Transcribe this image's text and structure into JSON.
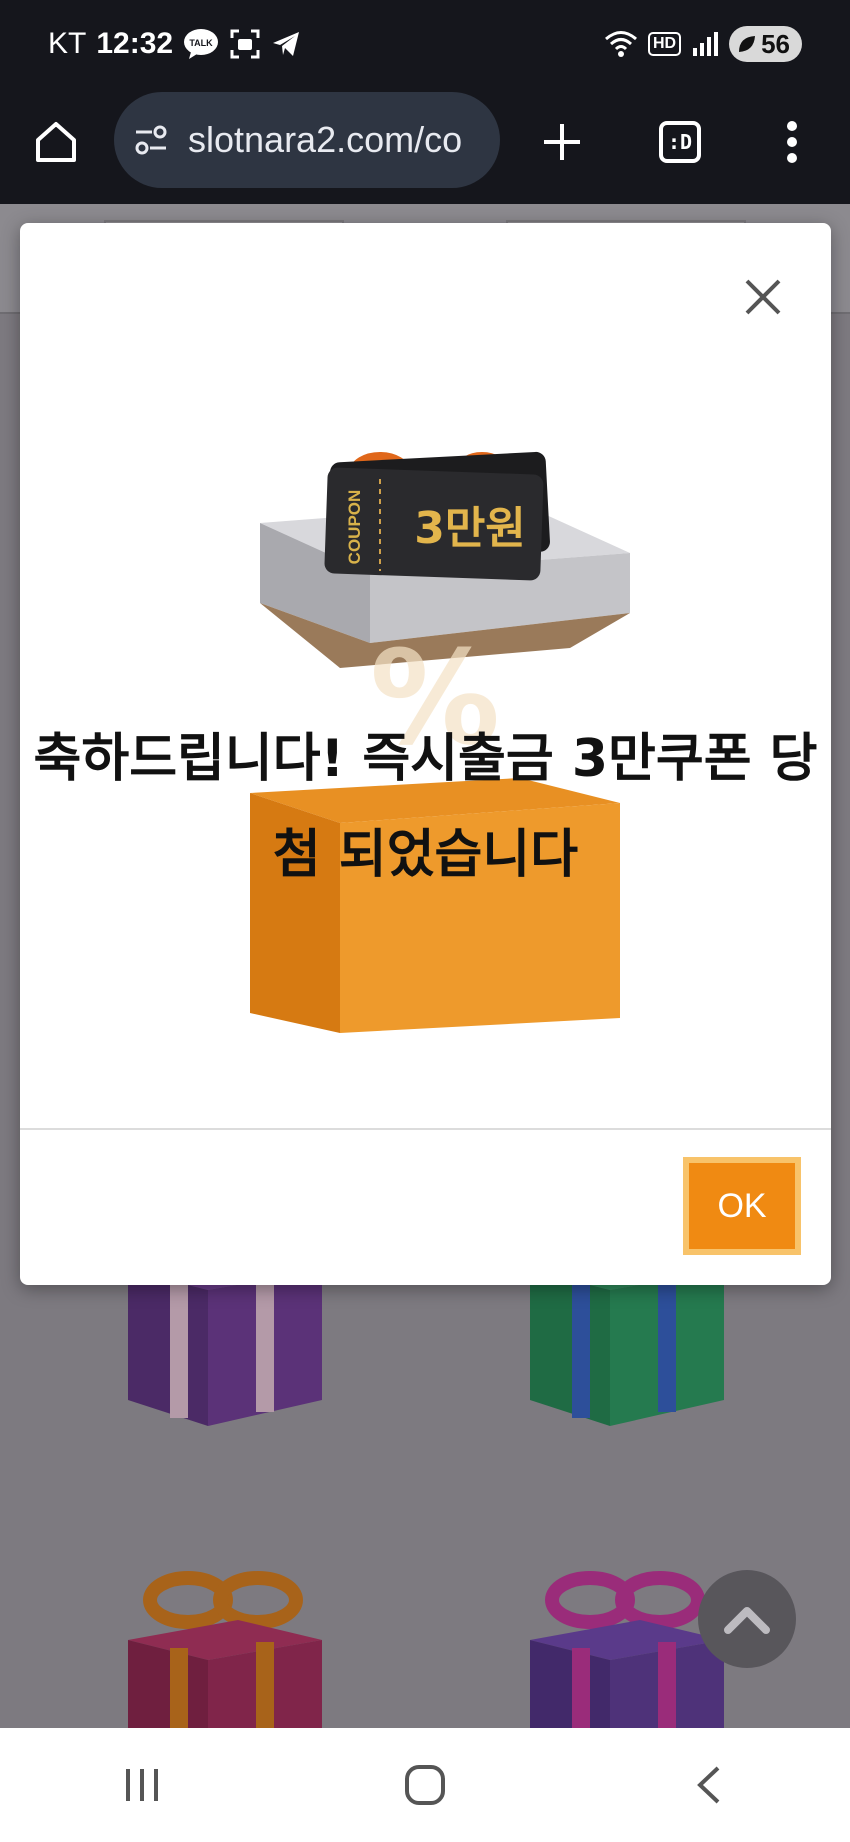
{
  "status_bar": {
    "carrier": "KT",
    "time": "12:32",
    "talk_badge": "TALK",
    "battery": "56",
    "hd_label": "HD"
  },
  "browser": {
    "url": "slotnara2.com/co",
    "tab_switcher_label": ":D"
  },
  "modal": {
    "coupon_tag": "COUPON",
    "coupon_amount": "3만원",
    "message": "축하드립니다! 즉시출금 3만쿠폰 당첨 되었습니다",
    "ok_label": "OK"
  },
  "colors": {
    "accent_orange": "#f08a12",
    "ok_border": "#f8c36a",
    "overlay": "#7d7a80",
    "browser_chrome": "#15161c"
  },
  "icons": [
    "home-icon",
    "site-settings-icon",
    "new-tab-icon",
    "tab-switcher-icon",
    "more-menu-icon",
    "close-icon",
    "chevron-up-icon",
    "recents-icon",
    "home-nav-icon",
    "back-icon"
  ]
}
